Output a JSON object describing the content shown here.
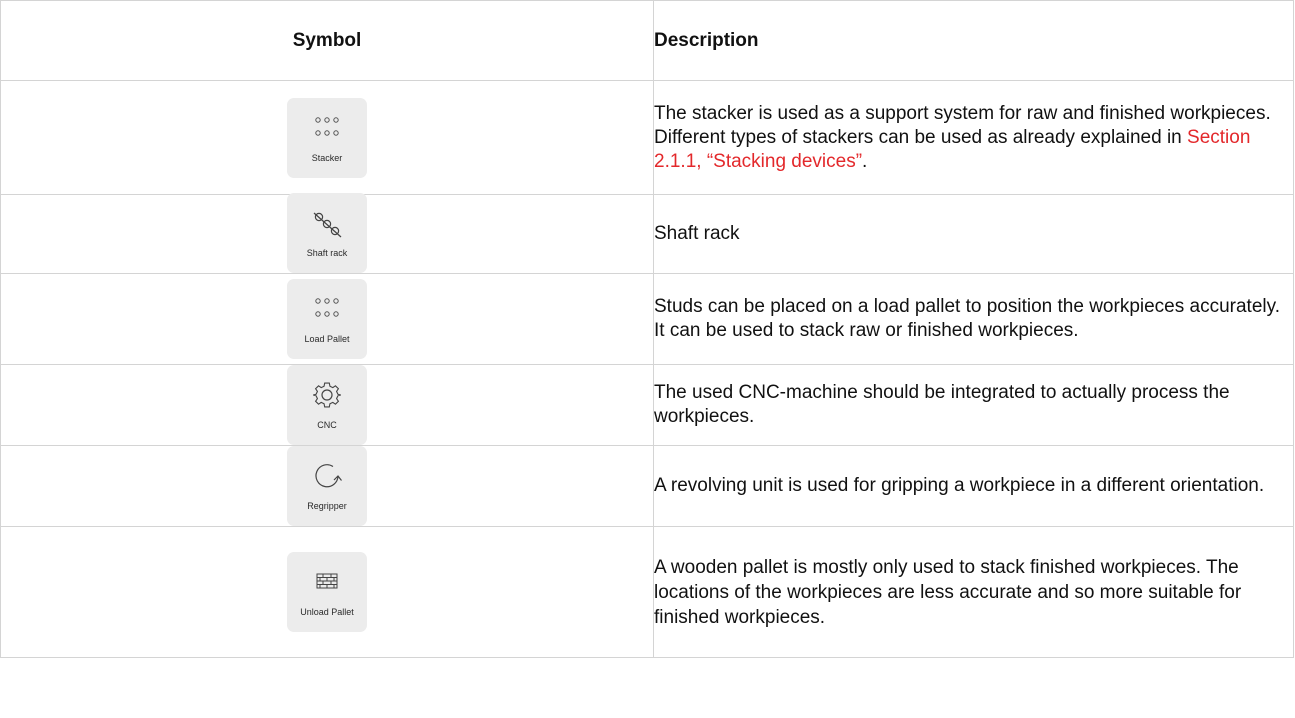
{
  "table": {
    "headers": {
      "symbol": "Symbol",
      "description": "Description"
    },
    "rows": [
      {
        "icon": "stacker-icon",
        "label": "Stacker",
        "desc_before": "The stacker is used as a support system for raw and finished workpieces. Different types of stackers can be used as already explained in ",
        "link": "Section 2.1.1, “Stacking devices”",
        "desc_after": "."
      },
      {
        "icon": "shaft-rack-icon",
        "label": "Shaft rack",
        "desc": "Shaft rack"
      },
      {
        "icon": "load-pallet-icon",
        "label": "Load Pallet",
        "desc": "Studs can be placed on a load pallet to position the workpieces accurately. It can be used to stack raw or finished workpieces."
      },
      {
        "icon": "gear-icon",
        "label": "CNC",
        "desc": "The used CNC-machine should be integrated to actually process the workpieces."
      },
      {
        "icon": "rotate-arrow-icon",
        "label": "Regripper",
        "desc": "A revolving unit is used for gripping a workpiece in a different orientation."
      },
      {
        "icon": "pallet-grid-icon",
        "label": "Unload Pallet",
        "desc": "A wooden pallet is mostly only used to stack finished workpieces. The locations of the workpieces are less accurate and so more suitable for finished workpieces."
      }
    ]
  },
  "colors": {
    "link": "#e3282b",
    "tile": "#ececec",
    "border": "#d4d4d4"
  }
}
